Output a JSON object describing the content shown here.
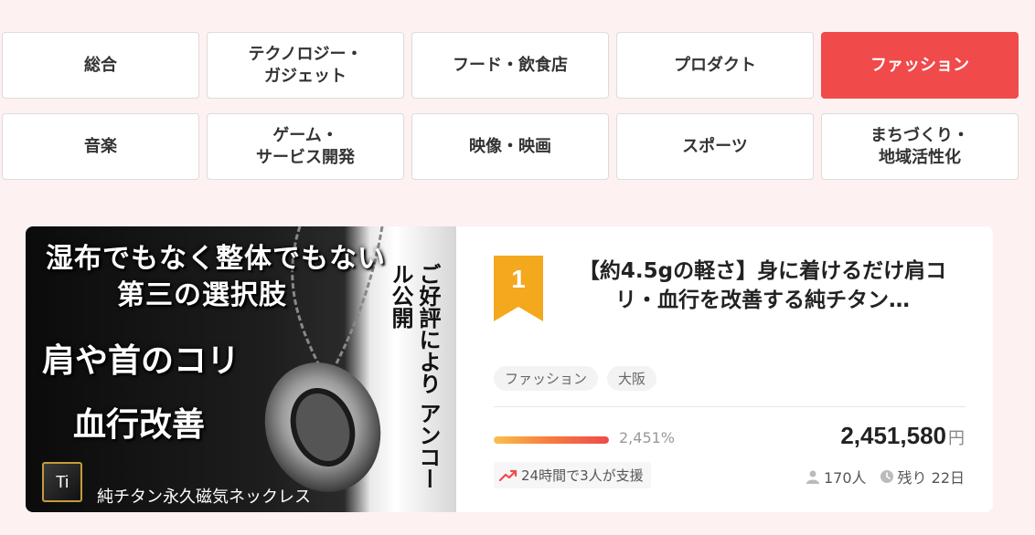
{
  "categories": [
    {
      "label": "総合",
      "active": false
    },
    {
      "label": "テクノロジー・\nガジェット",
      "active": false
    },
    {
      "label": "フード・飲食店",
      "active": false
    },
    {
      "label": "プロダクト",
      "active": false
    },
    {
      "label": "ファッション",
      "active": true
    },
    {
      "label": "音楽",
      "active": false
    },
    {
      "label": "ゲーム・\nサービス開発",
      "active": false
    },
    {
      "label": "映像・映画",
      "active": false
    },
    {
      "label": "スポーツ",
      "active": false
    },
    {
      "label": "まちづくり・\n地域活性化",
      "active": false
    }
  ],
  "project": {
    "rank": "1",
    "title": "【約4.5gの軽さ】身に着けるだけ肩コリ・血行を改善する純チタン…",
    "tags": [
      "ファッション",
      "大阪"
    ],
    "progress_percent": 2451,
    "percent_label": "2,451%",
    "amount": "2,451,580",
    "currency": "円",
    "trend_text": "24時間で3人が支援",
    "supporters": "170人",
    "remaining": "残り 22日",
    "thumbnail": {
      "line1": "湿布でもなく整体でもない",
      "line2": "第三の選択肢",
      "line3": "肩や首のコリ",
      "line4": "血行改善",
      "vertical": "ご好評により アンコール公開",
      "caption": "純チタン永久磁気ネックレス",
      "badge": "Ti"
    }
  },
  "colors": {
    "accent": "#f04a4a",
    "rank_gold": "#f4a81d",
    "background": "#fdf1f1"
  }
}
